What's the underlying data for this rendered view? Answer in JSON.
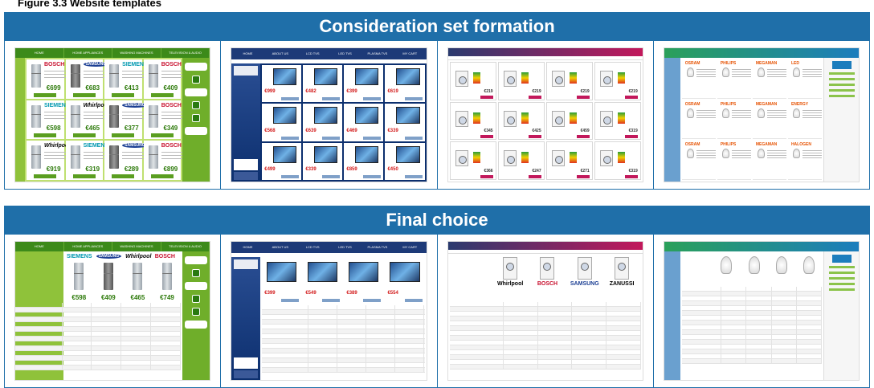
{
  "figure": {
    "caption": "Figure 3.3 Website templates"
  },
  "sections": [
    {
      "id": "consideration",
      "title": "Consideration set formation"
    },
    {
      "id": "final",
      "title": "Final choice"
    }
  ],
  "colors": {
    "band": "#1f6fa9",
    "green_site": "#3c8a1a",
    "tv_site": "#1d3a78",
    "wm_site": "#c2185b",
    "bulb_site": "#1c7dbd"
  },
  "fridge_site": {
    "nav": [
      "HOME",
      "HOME APPLIANCES",
      "WASHING MACHINES",
      "TELEVISION & AUDIO"
    ],
    "items": [
      {
        "brand": "BOSCH",
        "style": "bosch",
        "price": "€699"
      },
      {
        "brand": "SAMSUNG",
        "style": "samsung",
        "price": "€683"
      },
      {
        "brand": "SIEMENS",
        "style": "siemens",
        "price": "€413"
      },
      {
        "brand": "BOSCH",
        "style": "bosch",
        "price": "€409"
      },
      {
        "brand": "SIEMENS",
        "style": "siemens",
        "price": "€598"
      },
      {
        "brand": "Whirlpool",
        "style": "whirl",
        "price": "€465"
      },
      {
        "brand": "SAMSUNG",
        "style": "samsung",
        "price": "€377"
      },
      {
        "brand": "BOSCH",
        "style": "bosch",
        "price": "€349"
      },
      {
        "brand": "Whirlpool",
        "style": "whirl",
        "price": "€919"
      },
      {
        "brand": "SIEMENS",
        "style": "siemens",
        "price": "€319"
      },
      {
        "brand": "SAMSUNG",
        "style": "samsung",
        "price": "€289"
      },
      {
        "brand": "BOSCH",
        "style": "bosch",
        "price": "€899"
      }
    ],
    "final_items": [
      {
        "brand": "SIEMENS",
        "style": "siemens",
        "price": "€598"
      },
      {
        "brand": "SAMSUNG",
        "style": "samsung",
        "price": "€409"
      },
      {
        "brand": "Whirlpool",
        "style": "whirl",
        "price": "€465"
      },
      {
        "brand": "BOSCH",
        "style": "bosch",
        "price": "€749"
      }
    ]
  },
  "tv_site": {
    "nav": [
      "HOME",
      "ABOUT US",
      "LCD TVS",
      "LED TVS",
      "PLASMA TVS",
      "MY CART"
    ],
    "items": [
      {
        "price": "€999"
      },
      {
        "price": "€482"
      },
      {
        "price": "€399"
      },
      {
        "price": "€619"
      },
      {
        "price": "€568"
      },
      {
        "price": "€639"
      },
      {
        "price": "€469"
      },
      {
        "price": "€339"
      },
      {
        "price": "€499"
      },
      {
        "price": "€339"
      },
      {
        "price": "€859"
      },
      {
        "price": "€450"
      }
    ],
    "final_items": [
      {
        "price": "€399"
      },
      {
        "price": "€549"
      },
      {
        "price": "€389"
      },
      {
        "price": "€554"
      }
    ]
  },
  "washing_site": {
    "items": [
      {
        "price": "€219"
      },
      {
        "price": "€219"
      },
      {
        "price": "€219"
      },
      {
        "price": "€219"
      },
      {
        "price": "€345"
      },
      {
        "price": "€425"
      },
      {
        "price": "€459"
      },
      {
        "price": "€319"
      },
      {
        "price": "€366"
      },
      {
        "price": "€247"
      },
      {
        "price": "€271"
      },
      {
        "price": "€319"
      }
    ],
    "final_brands": [
      "Whirlpool",
      "BOSCH",
      "SAMSUNG",
      "ZANUSSI"
    ]
  },
  "bulb_site": {
    "items": [
      {
        "brand": "OSRAM"
      },
      {
        "brand": "PHILIPS"
      },
      {
        "brand": "MEGAMAN"
      },
      {
        "brand": "LED"
      },
      {
        "brand": "OSRAM"
      },
      {
        "brand": "PHILIPS"
      },
      {
        "brand": "MEGAMAN"
      },
      {
        "brand": "ENERGY"
      },
      {
        "brand": "OSRAM"
      },
      {
        "brand": "PHILIPS"
      },
      {
        "brand": "MEGAMAN"
      },
      {
        "brand": "HALOGEN"
      }
    ]
  }
}
